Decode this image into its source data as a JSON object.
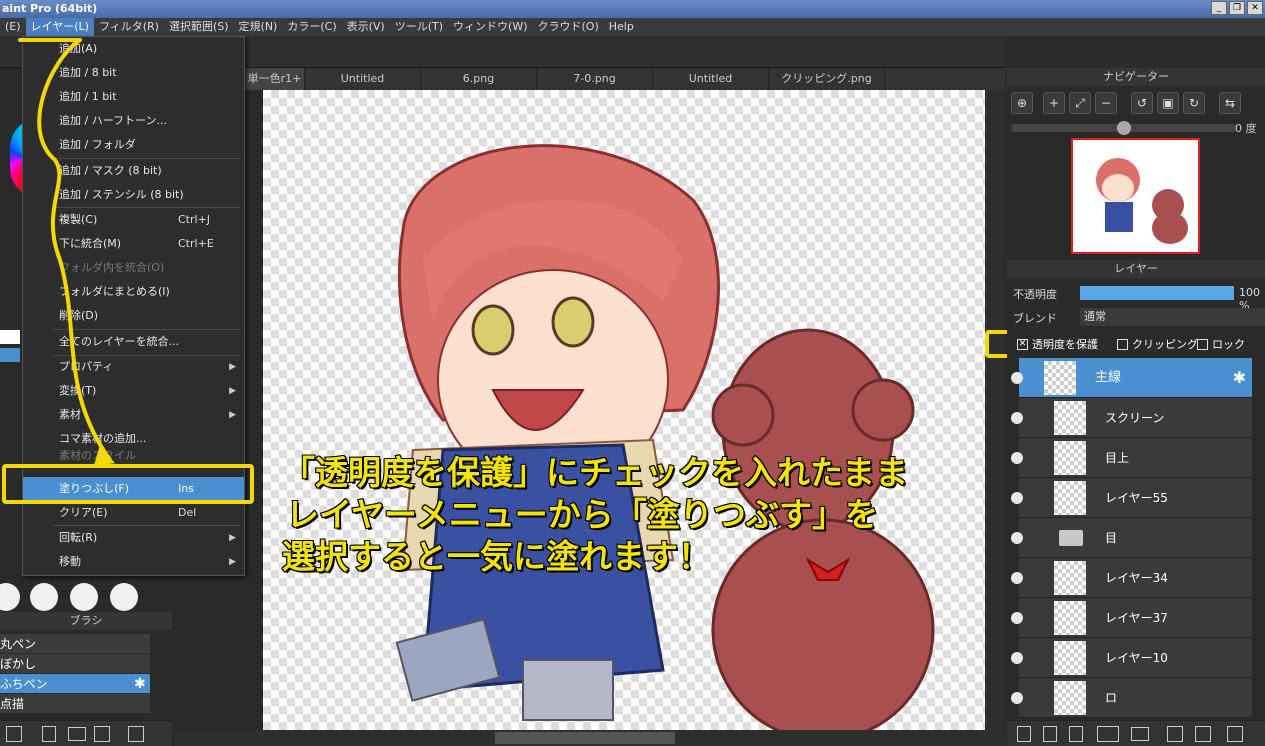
{
  "window": {
    "title": "aint Pro (64bit)",
    "buttons": [
      "_",
      "❐",
      "✕"
    ]
  },
  "menubar": {
    "items": [
      "(E)",
      "レイヤー(L)",
      "フィルタ(R)",
      "選択範囲(S)",
      "定規(N)",
      "カラー(C)",
      "表示(V)",
      "ツール(T)",
      "ウィンドウ(W)",
      "クラウド(O)",
      "Help"
    ]
  },
  "tabs": [
    "単一色r1+",
    "Untitled",
    "6.png",
    "7-0.png",
    "Untitled",
    "クリッピング.png"
  ],
  "dropdown": {
    "items": [
      {
        "label": "追加(A)",
        "shortcut": "",
        "arrow": false,
        "disabled": false
      },
      {
        "label": "追加 / 8 bit",
        "shortcut": "",
        "arrow": false,
        "disabled": false
      },
      {
        "label": "追加 / 1 bit",
        "shortcut": "",
        "arrow": false,
        "disabled": false
      },
      {
        "label": "追加 / ハーフトーン...",
        "shortcut": "",
        "arrow": false,
        "disabled": false
      },
      {
        "label": "追加 / フォルダ",
        "shortcut": "",
        "arrow": false,
        "disabled": false
      },
      {
        "label": "追加 / マスク (8 bit)",
        "shortcut": "",
        "arrow": false,
        "disabled": false
      },
      {
        "label": "追加 / ステンシル (8 bit)",
        "shortcut": "",
        "arrow": false,
        "disabled": false
      },
      {
        "label": "複製(C)",
        "shortcut": "Ctrl+J",
        "arrow": false,
        "disabled": false
      },
      {
        "label": "下に統合(M)",
        "shortcut": "Ctrl+E",
        "arrow": false,
        "disabled": false
      },
      {
        "label": "フォルダ内を統合(O)",
        "shortcut": "",
        "arrow": false,
        "disabled": true
      },
      {
        "label": "フォルダにまとめる(I)",
        "shortcut": "",
        "arrow": false,
        "disabled": false
      },
      {
        "label": "削除(D)",
        "shortcut": "",
        "arrow": false,
        "disabled": false
      },
      {
        "label": "全てのレイヤーを統合...",
        "shortcut": "",
        "arrow": false,
        "disabled": false
      },
      {
        "label": "プロパティ",
        "shortcut": "",
        "arrow": true,
        "disabled": false
      },
      {
        "label": "変換(T)",
        "shortcut": "",
        "arrow": true,
        "disabled": false
      },
      {
        "label": "素材",
        "shortcut": "",
        "arrow": true,
        "disabled": false
      },
      {
        "label": "コマ素材の追加...",
        "shortcut": "",
        "arrow": false,
        "disabled": false
      },
      {
        "label": "素材のスタイル",
        "shortcut": "",
        "arrow": false,
        "disabled": true
      },
      {
        "label": "塗りつぶし(F)",
        "shortcut": "Ins",
        "arrow": false,
        "disabled": false
      },
      {
        "label": "クリア(E)",
        "shortcut": "Del",
        "arrow": false,
        "disabled": false
      },
      {
        "label": "回転(R)",
        "shortcut": "",
        "arrow": true,
        "disabled": false
      },
      {
        "label": "移動",
        "shortcut": "",
        "arrow": true,
        "disabled": false
      }
    ]
  },
  "brush_panel": {
    "title": "ブラシ",
    "items": [
      "丸ペン",
      "ぼかし",
      "ふちペン",
      "点描"
    ],
    "selected": "ふちペン"
  },
  "navigator": {
    "title": "ナビゲーター",
    "zoom": "0 度"
  },
  "layer_panel": {
    "title": "レイヤー",
    "opacity_label": "不透明度",
    "opacity_value": "100 %",
    "opacity_fraction": 1.0,
    "blend_label": "ブレンド",
    "blend_value": "通常",
    "protect_alpha": "透明度を保護",
    "clipping": "クリッピング",
    "lock": "ロック",
    "layers": [
      "主線",
      "スクリーン",
      "目上",
      "レイヤー55",
      "目",
      "レイヤー34",
      "レイヤー37",
      "レイヤー10",
      "ロ"
    ]
  },
  "annotation": {
    "line1": "「透明度を保護」にチェックを入れたまま",
    "line2": "レイヤーメニューから「塗りつぶす」を",
    "line3": "選択すると一気に塗れます！"
  },
  "colors": {
    "highlight": "#f5d800",
    "accent": "#4a90d0"
  }
}
